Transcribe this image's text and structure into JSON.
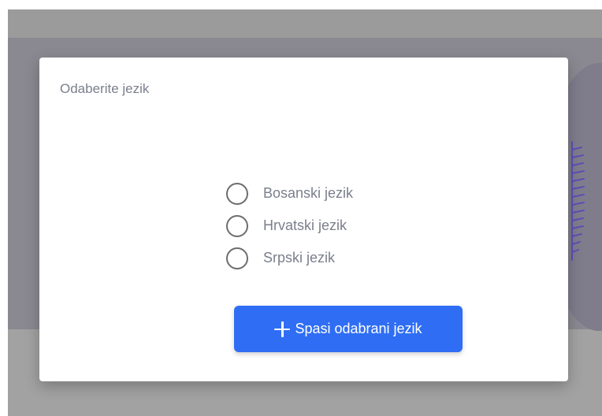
{
  "modal": {
    "title": "Odaberite jezik",
    "options": [
      {
        "label": "Bosanski jezik",
        "selected": false
      },
      {
        "label": "Hrvatski jezik",
        "selected": false
      },
      {
        "label": "Srpski jezik",
        "selected": false
      }
    ],
    "save_button": {
      "label": "Spasi odabrani jezik",
      "icon": "plus-icon"
    }
  },
  "colors": {
    "accent": "#2f6ef4",
    "overlay": "#8a8991",
    "text_muted": "#7b7f8c",
    "decoration": "#5b4fb8"
  }
}
